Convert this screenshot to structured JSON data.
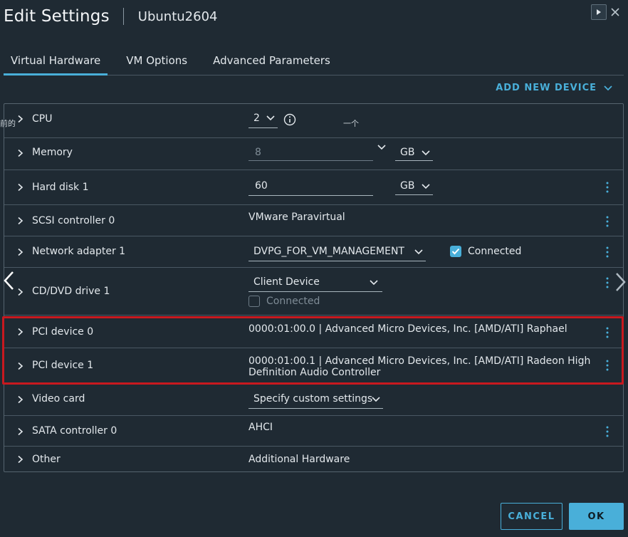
{
  "dialog": {
    "title": "Edit Settings",
    "vm_name": "Ubuntu2604"
  },
  "tabs": [
    {
      "label": "Virtual Hardware",
      "active": true
    },
    {
      "label": "VM Options",
      "active": false
    },
    {
      "label": "Advanced Parameters",
      "active": false
    }
  ],
  "add_device": {
    "label": "ADD NEW DEVICE"
  },
  "stray_text": {
    "left": "前的",
    "middle": "一个"
  },
  "rows": {
    "cpu": {
      "label": "CPU",
      "value": "2"
    },
    "memory": {
      "label": "Memory",
      "value": "8",
      "unit": "GB"
    },
    "hard_disk": {
      "label": "Hard disk 1",
      "value": "60",
      "unit": "GB"
    },
    "scsi": {
      "label": "SCSI controller 0",
      "value": "VMware Paravirtual"
    },
    "network": {
      "label": "Network adapter 1",
      "value": "DVPG_FOR_VM_MANAGEMENT",
      "connected_label": "Connected",
      "connected": true
    },
    "cddvd": {
      "label": "CD/DVD drive 1",
      "value": "Client Device",
      "connected_label": "Connected",
      "connected": false
    },
    "pci0": {
      "label": "PCI device 0",
      "value": "0000:01:00.0 | Advanced Micro Devices, Inc. [AMD/ATI] Raphael"
    },
    "pci1": {
      "label": "PCI device 1",
      "value_line1": "0000:01:00.1 | Advanced Micro Devices, Inc. [AMD/ATI] Radeon High",
      "value_line2": "Definition Audio Controller"
    },
    "video": {
      "label": "Video card",
      "value": "Specify custom settings"
    },
    "sata": {
      "label": "SATA controller 0",
      "value": "AHCI"
    },
    "other": {
      "label": "Other",
      "value": "Additional Hardware"
    }
  },
  "buttons": {
    "cancel": "CANCEL",
    "ok": "OK"
  },
  "colors": {
    "background": "#1f2a33",
    "accent": "#49afd9",
    "highlight": "#c8191f",
    "border": "#4a5863"
  }
}
